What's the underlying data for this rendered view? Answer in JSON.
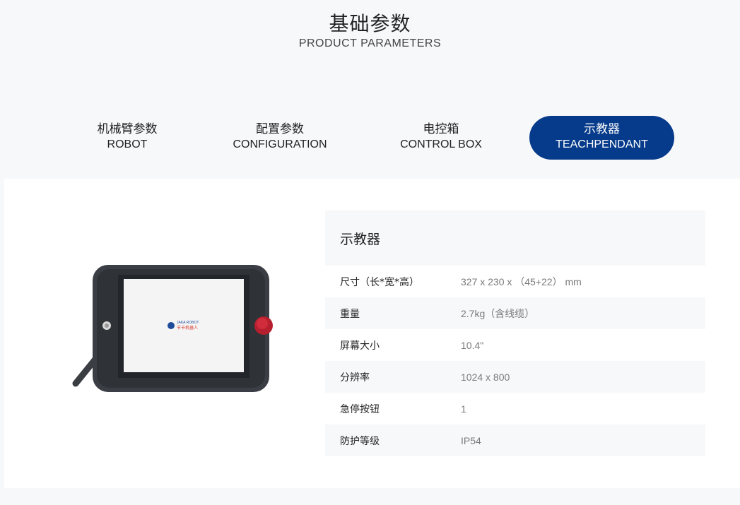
{
  "header": {
    "title_cn": "基础参数",
    "title_en": "PRODUCT PARAMETERS"
  },
  "tabs": [
    {
      "cn": "机械臂参数",
      "en": "ROBOT",
      "active": false
    },
    {
      "cn": "配置参数",
      "en": "CONFIGURATION",
      "active": false
    },
    {
      "cn": "电控箱",
      "en": "CONTROL BOX",
      "active": false
    },
    {
      "cn": "示教器",
      "en": "TEACHPENDANT",
      "active": true
    }
  ],
  "colors": {
    "accent": "#063a8a",
    "page_bg": "#f7f8fa",
    "card_bg": "#ffffff",
    "value_text": "#7a7a7a"
  },
  "product_image": {
    "icon": "teach-pendant-image",
    "screen_logo_en": "JAKA ROBOT",
    "screen_logo_cn": "节卡机器人"
  },
  "spec": {
    "title": "示教器",
    "rows": [
      {
        "key": "尺寸（长*宽*高）",
        "value": "327 x 230 x （45+22） mm"
      },
      {
        "key": "重量",
        "value": "2.7kg（含线缆）"
      },
      {
        "key": "屏幕大小",
        "value": "10.4\""
      },
      {
        "key": "分辨率",
        "value": "1024 x 800"
      },
      {
        "key": "急停按钮",
        "value": "1"
      },
      {
        "key": "防护等级",
        "value": "IP54"
      }
    ]
  }
}
